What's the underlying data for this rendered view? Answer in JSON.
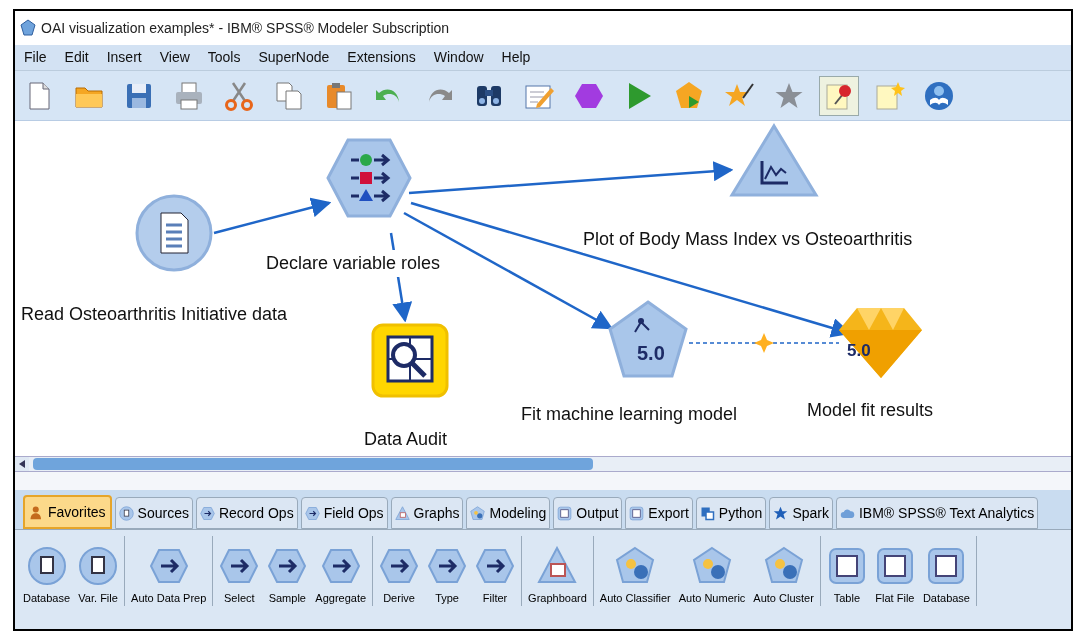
{
  "window": {
    "title": "OAI visualization examples* - IBM® SPSS® Modeler Subscription"
  },
  "menu": [
    "File",
    "Edit",
    "Insert",
    "View",
    "Tools",
    "SuperNode",
    "Extensions",
    "Window",
    "Help"
  ],
  "toolbar": [
    {
      "kind": "new",
      "pressed": false
    },
    {
      "kind": "open",
      "pressed": false
    },
    {
      "kind": "save",
      "pressed": false
    },
    {
      "kind": "print",
      "pressed": false
    },
    {
      "kind": "cut",
      "pressed": false
    },
    {
      "kind": "copy",
      "pressed": false
    },
    {
      "kind": "paste",
      "pressed": false
    },
    {
      "kind": "undo",
      "pressed": false
    },
    {
      "kind": "redo",
      "pressed": false
    },
    {
      "kind": "find",
      "pressed": false
    },
    {
      "kind": "edit",
      "pressed": false
    },
    {
      "kind": "stop",
      "pressed": false
    },
    {
      "kind": "run",
      "pressed": false
    },
    {
      "kind": "runsel",
      "pressed": false
    },
    {
      "kind": "star",
      "pressed": false
    },
    {
      "kind": "graystar",
      "pressed": false
    },
    {
      "kind": "pin",
      "pressed": true
    },
    {
      "kind": "note",
      "pressed": false
    },
    {
      "kind": "spell",
      "pressed": false
    }
  ],
  "nodes": [
    {
      "label": "Read Osteoarthritis Initiative data",
      "kind": "source"
    },
    {
      "label": "Declare variable roles",
      "kind": "type"
    },
    {
      "label": "Plot of Body Mass Index vs Osteoarthritis",
      "kind": "graph"
    },
    {
      "label": "Data Audit",
      "kind": "output"
    },
    {
      "label": "Fit machine learning model",
      "kind": "model",
      "icon_text": "5.0"
    },
    {
      "label": "Model fit results",
      "kind": "nugget",
      "icon_text": "5.0"
    }
  ],
  "palette": {
    "tabs": [
      {
        "label": "Favorites",
        "kind": "person",
        "selected": true
      },
      {
        "label": "Sources",
        "kind": "circle",
        "selected": false
      },
      {
        "label": "Record Ops",
        "kind": "hexagon",
        "selected": false
      },
      {
        "label": "Field Ops",
        "kind": "hexagon",
        "selected": false
      },
      {
        "label": "Graphs",
        "kind": "triangle",
        "selected": false
      },
      {
        "label": "Modeling",
        "kind": "pentagon",
        "selected": false
      },
      {
        "label": "Output",
        "kind": "square",
        "selected": false
      },
      {
        "label": "Export",
        "kind": "square",
        "selected": false
      },
      {
        "label": "Python",
        "kind": "python",
        "selected": false
      },
      {
        "label": "Spark",
        "kind": "star",
        "selected": false
      },
      {
        "label": "IBM® SPSS® Text Analytics",
        "kind": "cloud",
        "selected": false
      }
    ],
    "groups": [
      [
        {
          "label": "Database",
          "kind": "circle"
        },
        {
          "label": "Var. File",
          "kind": "circle"
        }
      ],
      [
        {
          "label": "Auto Data Prep",
          "kind": "hexagon"
        }
      ],
      [
        {
          "label": "Select",
          "kind": "hexagon"
        },
        {
          "label": "Sample",
          "kind": "hexagon"
        },
        {
          "label": "Aggregate",
          "kind": "hexagon"
        }
      ],
      [
        {
          "label": "Derive",
          "kind": "hexagon"
        },
        {
          "label": "Type",
          "kind": "hexagon"
        },
        {
          "label": "Filter",
          "kind": "hexagon"
        }
      ],
      [
        {
          "label": "Graphboard",
          "kind": "triangle"
        }
      ],
      [
        {
          "label": "Auto Classifier",
          "kind": "pentagon"
        },
        {
          "label": "Auto Numeric",
          "kind": "pentagon"
        },
        {
          "label": "Auto Cluster",
          "kind": "pentagon"
        }
      ],
      [
        {
          "label": "Table",
          "kind": "square"
        },
        {
          "label": "Flat File",
          "kind": "square"
        },
        {
          "label": "Database",
          "kind": "square"
        }
      ]
    ]
  }
}
